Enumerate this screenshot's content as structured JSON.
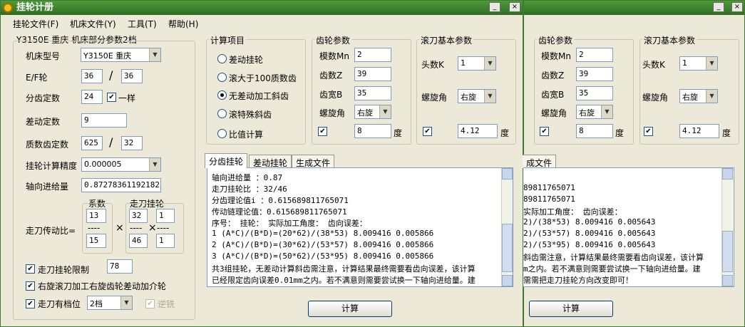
{
  "window": {
    "title": "挂轮计册",
    "title_icon": "gear-icon",
    "minimize": "_",
    "close": "×",
    "accent": "#3c8030"
  },
  "menu": [
    "挂轮文件(F)",
    "机床文件(Y)",
    "工具(T)",
    "帮助(H)"
  ],
  "machine_header": "Y3150E  重庆  机床部分参数2档",
  "left": {
    "machine_type_label": "机床型号",
    "machine_type": "Y3150E 重庆",
    "ef_label": "E/F轮",
    "ef_e": "36",
    "ef_f": "36",
    "slash": "/",
    "fen_label": "分齿定数",
    "fen_value": "24",
    "same_label": "一样",
    "same_checked": "✔",
    "diff_label": "差动定数",
    "diff_value": "9",
    "prime_label": "质数齿定数",
    "prime_a": "625",
    "prime_b": "32",
    "precision_label": "挂轮计算精度",
    "precision": "0.000005",
    "axial_label": "轴向进给量",
    "axial_value": "0.872783611921823",
    "coef_label": "系数",
    "gear_label": "走刀挂轮",
    "ratio_label": "走刀传动比=",
    "coef_top": "13",
    "coef_bottom": "15",
    "dashes": "----",
    "gear_a": "32",
    "gear_b": "1",
    "gear_c": "46",
    "gear_d": "1",
    "times": "×",
    "limit_label": "走刀挂轮限制",
    "limit_value": "78",
    "limit_checked": "✔",
    "right_hob_label": "右旋滚刀加工右旋齿轮差动加介轮",
    "right_hob_checked": "✔",
    "gear_pos_label": "走刀有档位",
    "gear_pos_checked": "✔",
    "gear_pos_value": "2档",
    "climb_label": "逆铣",
    "climb_checked": "✔"
  },
  "calc": {
    "title": "计算项目",
    "items": [
      "差动挂轮",
      "滚大于100质数齿",
      "无差动加工斜齿",
      "滚特殊斜齿",
      "比值计算"
    ],
    "selected_index": 2
  },
  "gear_params": {
    "title": "齿轮参数",
    "module_label": "模数Mn",
    "module": "2",
    "teeth_label": "齿数Z",
    "teeth": "39",
    "width_label": "齿宽B",
    "width": "35",
    "helix_label": "螺旋角",
    "helix_dir": "右旋",
    "angle": "8",
    "angle_unit": "度",
    "angle_checked": "✔"
  },
  "hob_params": {
    "title": "滚刀基本参数",
    "starts_label": "头数K",
    "starts": "1",
    "helix_label": "螺旋角",
    "helix_dir": "右旋",
    "angle": "4.12",
    "angle_unit": "度",
    "angle_checked": "✔"
  },
  "tabs": [
    "分齿挂轮",
    "差动挂轮",
    "生成文件"
  ],
  "output": {
    "lines": [
      "轴向进给量  ：0.87",
      "走刀挂轮比  ：32/46",
      "分齿理论值i ：0.615689811765071",
      "传动链理论值：0.615689811765071",
      "序号：    挂轮：           实际加工角度： 齿向误差：",
      "1    (A*C)/(B*D)=(20*62)/(38*53)   8.009416   0.005866",
      "2    (A*C)/(B*D)=(30*62)/(53*57)   8.009416   0.005866",
      "3    (A*C)/(B*D)=(50*62)/(53*95)   8.009416   0.005866",
      "共3组挂轮，无差动计算斜齿需注意，计算结果最终需要看齿向误差，该计算",
      "已经限定齿向误差0.01mm之内。若不满意则需要尝试换一下轴向进给量。建"
    ]
  },
  "calc_button": "计算",
  "second": {
    "tab": "成文件",
    "output_lines": [
      "89811765071",
      "89811765071",
      "            实际加工角度： 齿向误差：",
      "2)/(38*53)    8.009416    0.005643",
      "2)/(53*57)    8.009416    0.005643",
      "2)/(53*95)    8.009416    0.005643",
      "斜齿需注意，计算结果最终需要看齿向误差，该计算",
      "m之内。若不满意则需要尝试换一下轴向进给量。建",
      "需需把走刀挂轮方向改变即可！"
    ],
    "calc_button": "计算"
  }
}
